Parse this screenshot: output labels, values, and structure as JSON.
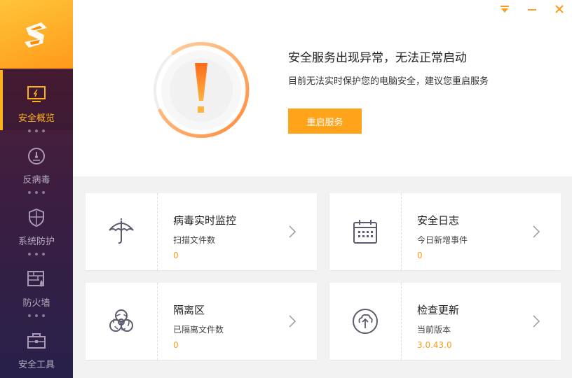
{
  "window": {
    "menu_icon": "dropdown-menu-icon",
    "minimize_icon": "minimize-icon",
    "close_icon": "close-icon"
  },
  "sidebar": {
    "logo_icon": "app-logo-icon",
    "items": [
      {
        "label": "安全概览",
        "icon": "monitor-icon",
        "active": true
      },
      {
        "label": "反病毒",
        "icon": "gauge-icon",
        "active": false
      },
      {
        "label": "系统防护",
        "icon": "shield-icon",
        "active": false
      },
      {
        "label": "防火墙",
        "icon": "firewall-icon",
        "active": false
      },
      {
        "label": "安全工具",
        "icon": "toolbox-icon",
        "active": false
      }
    ]
  },
  "alert": {
    "icon": "exclamation-icon",
    "title": "安全服务出现异常，无法正常启动",
    "subtitle": "目前无法实时保护您的电脑安全，建议您重启服务",
    "button_label": "重启服务"
  },
  "cards": [
    {
      "title": "病毒实时监控",
      "sub": "扫描文件数",
      "value": "0",
      "icon": "umbrella-icon"
    },
    {
      "title": "安全日志",
      "sub": "今日新增事件",
      "value": "0",
      "icon": "calendar-icon"
    },
    {
      "title": "隔离区",
      "sub": "已隔离文件数",
      "value": "0",
      "icon": "biohazard-icon"
    },
    {
      "title": "检查更新",
      "sub": "当前版本",
      "value": "3.0.43.0",
      "icon": "upload-cloud-icon"
    }
  ],
  "colors": {
    "accent": "#ffa31a",
    "sidebar_top": "#5a1f33",
    "sidebar_bottom": "#27204a",
    "value_text": "#ff9a1a"
  }
}
